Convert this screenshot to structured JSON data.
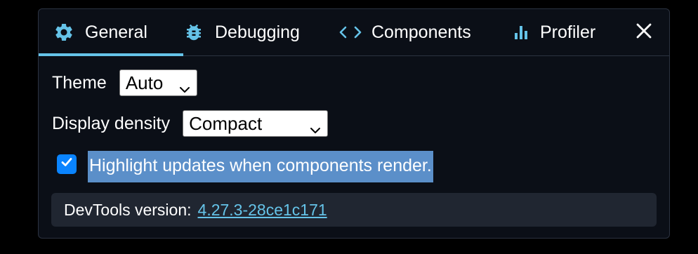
{
  "tabs": [
    {
      "id": "general",
      "label": "General",
      "icon": "gear-icon",
      "active": true
    },
    {
      "id": "debugging",
      "label": "Debugging",
      "icon": "bug-icon",
      "active": false
    },
    {
      "id": "components",
      "label": "Components",
      "icon": "code-brackets-icon",
      "active": false
    },
    {
      "id": "profiler",
      "label": "Profiler",
      "icon": "bar-chart-icon",
      "active": false
    }
  ],
  "close": {
    "icon": "close-icon"
  },
  "settings": {
    "theme": {
      "label": "Theme",
      "value": "Auto"
    },
    "density": {
      "label": "Display density",
      "value": "Compact"
    },
    "highlight": {
      "label": "Highlight updates when components render.",
      "checked": true
    }
  },
  "version": {
    "label": "DevTools version:",
    "value": "4.27.3-28ce1c171"
  },
  "colors": {
    "accent": "#65c3e8",
    "panel_bg": "#0b0f17",
    "selection": "#5b8fc9",
    "checkbox": "#0a84ff",
    "version_bg": "#202631"
  }
}
